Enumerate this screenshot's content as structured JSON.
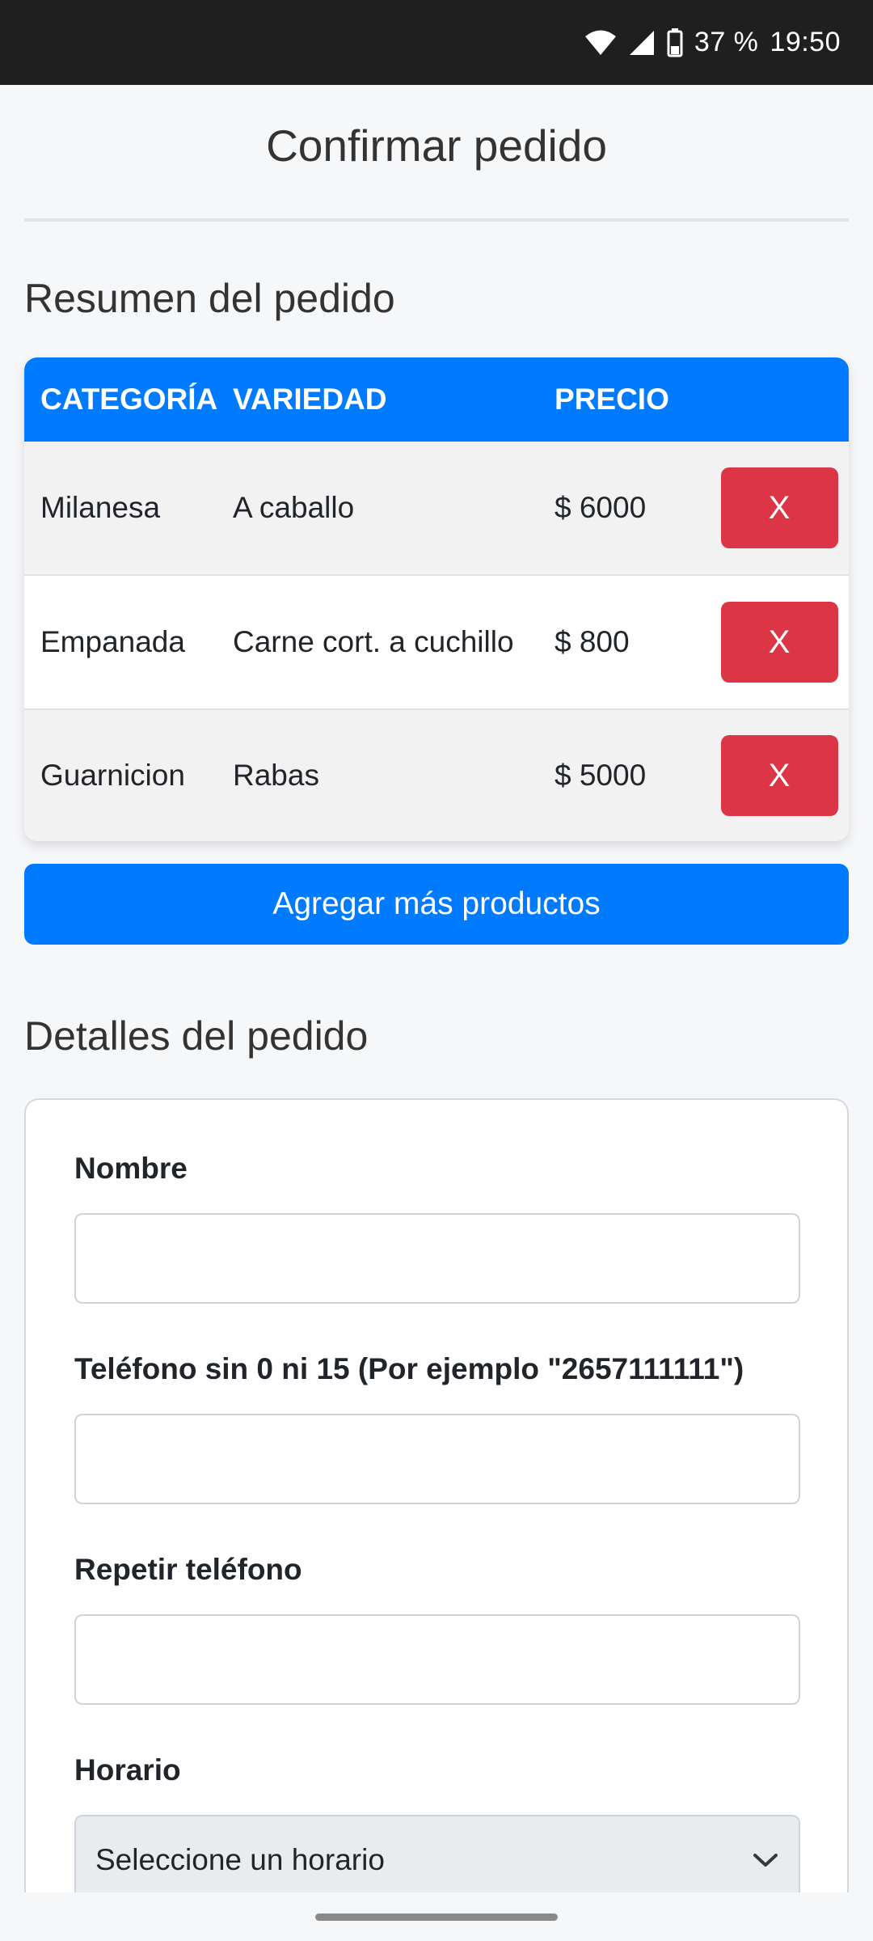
{
  "status_bar": {
    "battery": "37 %",
    "time": "19:50"
  },
  "page": {
    "title": "Confirmar pedido"
  },
  "summary": {
    "title": "Resumen del pedido",
    "columns": [
      "CATEGORÍA",
      "VARIEDAD",
      "PRECIO"
    ],
    "rows": [
      {
        "category": "Milanesa",
        "variety": "A caballo",
        "price": "$ 6000",
        "remove_label": "X"
      },
      {
        "category": "Empanada",
        "variety": "Carne cort. a cuchillo",
        "price": "$ 800",
        "remove_label": "X"
      },
      {
        "category": "Guarnicion",
        "variety": "Rabas",
        "price": "$ 5000",
        "remove_label": "X"
      }
    ],
    "add_button_label": "Agregar más productos"
  },
  "details": {
    "title": "Detalles del pedido",
    "name_label": "Nombre",
    "name_value": "",
    "phone_label": "Teléfono sin 0 ni 15 (Por ejemplo \"2657111111\")",
    "phone_value": "",
    "repeat_phone_label": "Repetir teléfono",
    "repeat_phone_value": "",
    "schedule_label": "Horario",
    "schedule_selected": "Seleccione un horario"
  },
  "colors": {
    "primary": "#007bff",
    "danger": "#dc3545",
    "status_bar": "#1f1f1f"
  },
  "icons": {
    "wifi": "wifi-icon",
    "signal": "signal-icon",
    "battery": "battery-icon",
    "select_arrow": "chevron-down-icon"
  }
}
